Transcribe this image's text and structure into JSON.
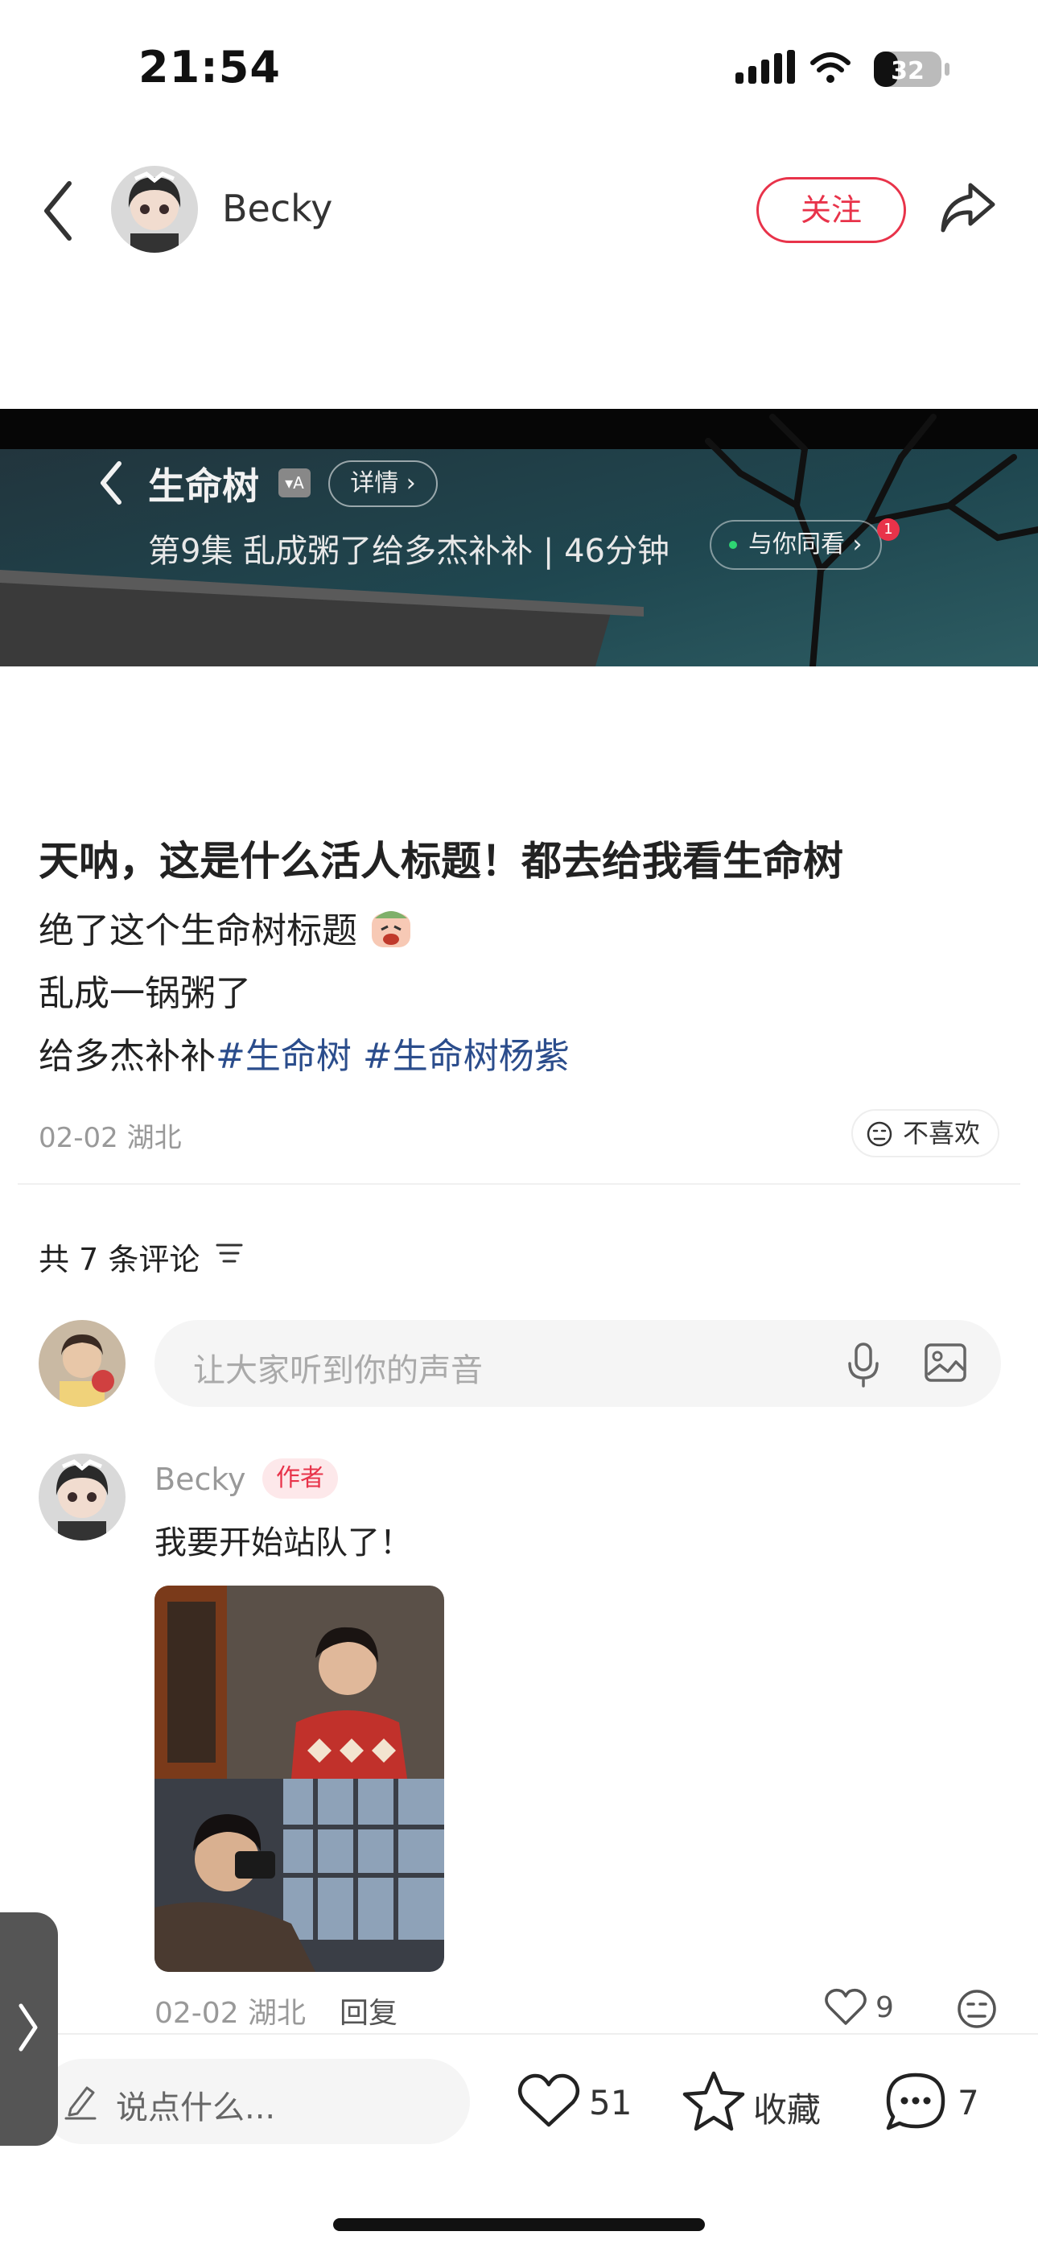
{
  "status_bar": {
    "time": "21:54",
    "battery": "32"
  },
  "header": {
    "author_name": "Becky",
    "follow_label": "关注"
  },
  "banner": {
    "title": "生命树",
    "badge": "▾A",
    "detail_label": "详情 ›",
    "subtitle": "第9集 乱成粥了给多杰补补 | 46分钟",
    "watch_label": "与你同看 ›",
    "watch_badge": "1"
  },
  "post": {
    "title": "天呐，这是什么活人标题！都去给我看生命树",
    "line1": "绝了这个生命树标题",
    "line2": "乱成一锅粥了",
    "line3_prefix": "给多杰补补",
    "hashtag1": "#生命树",
    "hashtag2": "#生命树杨紫",
    "meta": "02-02 湖北",
    "dislike_label": "不喜欢"
  },
  "comments": {
    "count_label": "共 7 条评论",
    "input_placeholder": "让大家听到你的声音",
    "items": [
      {
        "name": "Becky",
        "tag": "作者",
        "text": "我要开始站队了！",
        "meta": "02-02 湖北",
        "reply_label": "回复",
        "likes": "9"
      }
    ]
  },
  "bottom_bar": {
    "say_placeholder": "说点什么...",
    "likes": "51",
    "collect_label": "收藏",
    "comments": "7"
  },
  "colors": {
    "accent": "#e8334a",
    "hashtag": "#2b4d8c"
  }
}
